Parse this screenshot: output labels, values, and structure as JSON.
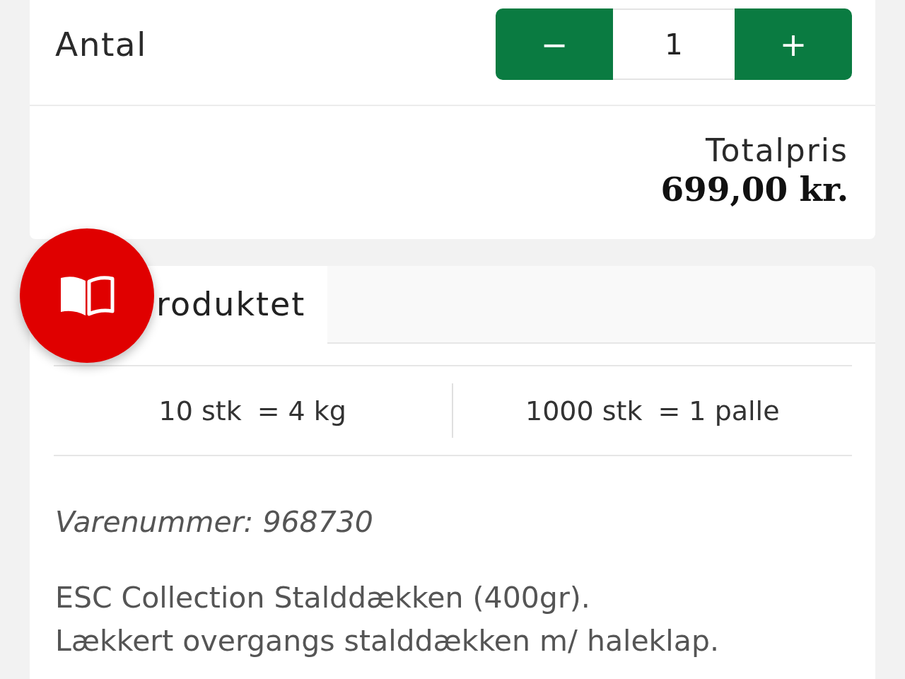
{
  "quantity": {
    "label": "Antal",
    "decrease": "−",
    "value": "1",
    "increase": "+"
  },
  "total": {
    "label": "Totalpris",
    "price": "699,00 kr."
  },
  "tabs": [
    {
      "label": "roduktet",
      "selected": true
    }
  ],
  "units": [
    {
      "amount": "10 stk",
      "equivalent": "= 4 kg"
    },
    {
      "amount": "1000 stk",
      "equivalent": "= 1 palle"
    }
  ],
  "product": {
    "item_number": "Varenummer: 968730",
    "description": [
      "ESC Collection Stalddækken (400gr).",
      "Lækkert overgangs stalddækken m/ haleklap."
    ]
  }
}
